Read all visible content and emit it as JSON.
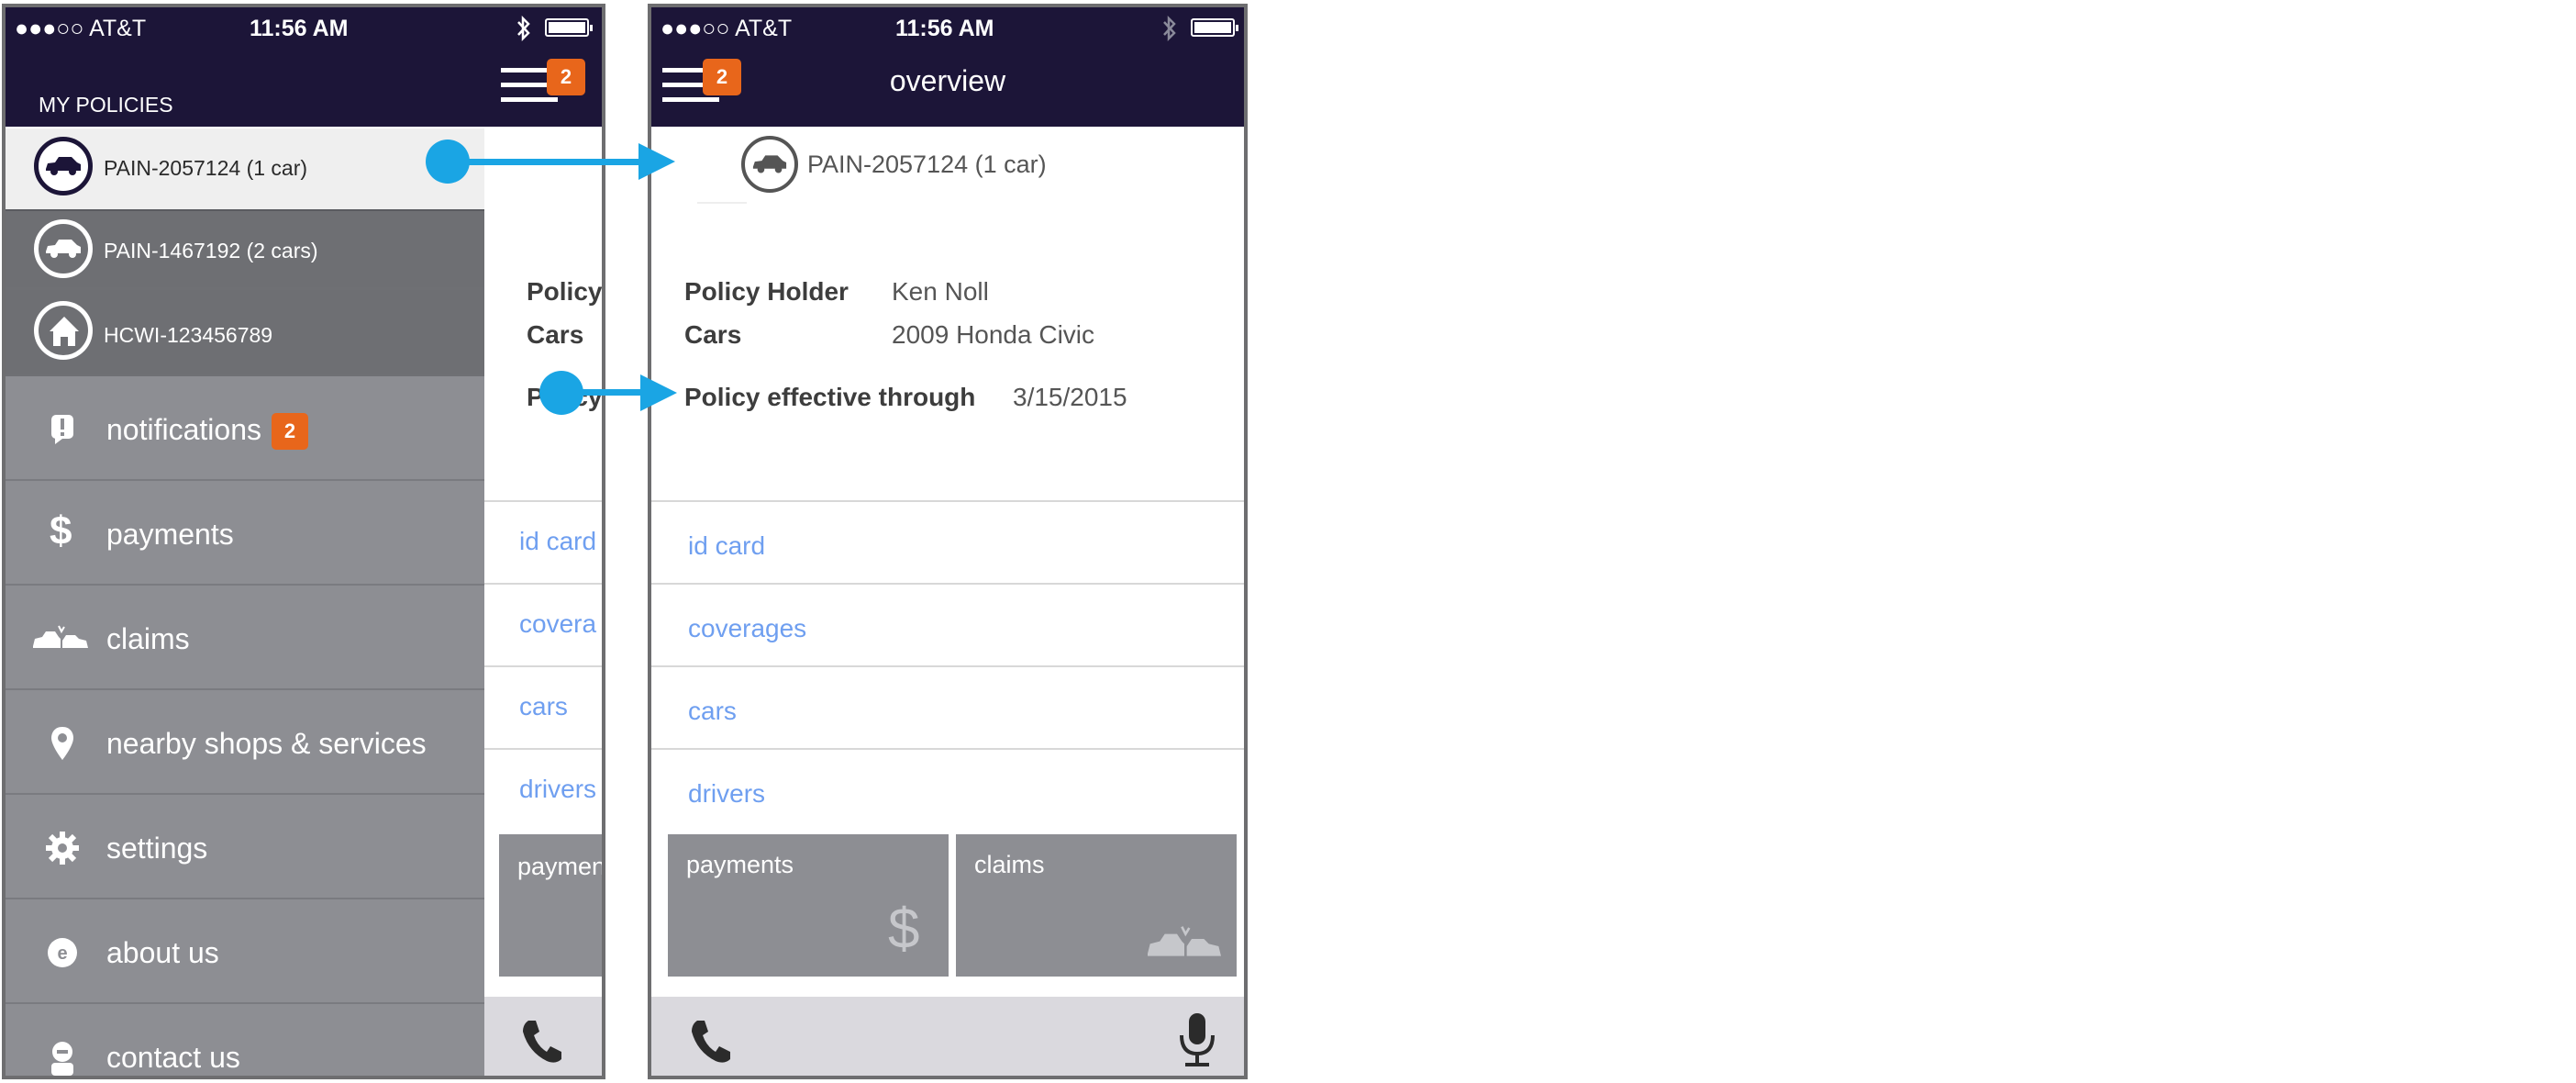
{
  "status": {
    "carrier": "●●●○○ AT&T",
    "time": "11:56 AM"
  },
  "left": {
    "nav_badge": "2",
    "section_title": "MY POLICIES",
    "policies": [
      {
        "label": "PAIN-2057124 (1 car)",
        "icon": "car-icon"
      },
      {
        "label": "PAIN-1467192 (2 cars)",
        "icon": "car-icon"
      },
      {
        "label": "HCWI-123456789",
        "icon": "house-icon"
      }
    ],
    "menu": [
      {
        "label": "notifications",
        "icon": "alert-icon",
        "badge": "2"
      },
      {
        "label": "payments",
        "icon": "dollar-icon"
      },
      {
        "label": "claims",
        "icon": "car-crash-icon"
      },
      {
        "label": "nearby shops & services",
        "icon": "location-pin-icon"
      },
      {
        "label": "settings",
        "icon": "gear-icon"
      },
      {
        "label": "about us",
        "icon": "about-e-icon"
      },
      {
        "label": "contact us",
        "icon": "agent-icon"
      }
    ],
    "peek": {
      "policy_label": "Policy",
      "cars_label": "Cars",
      "eff_label": "Policy",
      "links": [
        "id card",
        "covera",
        "cars",
        "drivers"
      ],
      "tile": "paymen"
    }
  },
  "right": {
    "title": "overview",
    "nav_badge": "2",
    "policy_id": "PAIN-2057124 (1 car)",
    "details": [
      {
        "label": "Policy Holder",
        "value": "Ken Noll"
      },
      {
        "label": "Cars",
        "value": "2009 Honda Civic"
      },
      {
        "label": "Policy effective through",
        "value": "3/15/2015"
      }
    ],
    "links": [
      "id card",
      "coverages",
      "cars",
      "drivers"
    ],
    "tiles": [
      {
        "label": "payments",
        "icon": "dollar-icon"
      },
      {
        "label": "claims",
        "icon": "car-crash-icon"
      }
    ],
    "bottom_icons": [
      "phone-icon",
      "microphone-icon"
    ]
  },
  "colors": {
    "nav": "#1c1538",
    "menu": "#8d8e93",
    "active_row": "#efefef",
    "accent_badge": "#e8661b",
    "link": "#6f9ff0",
    "arrow": "#1aa5e4"
  }
}
